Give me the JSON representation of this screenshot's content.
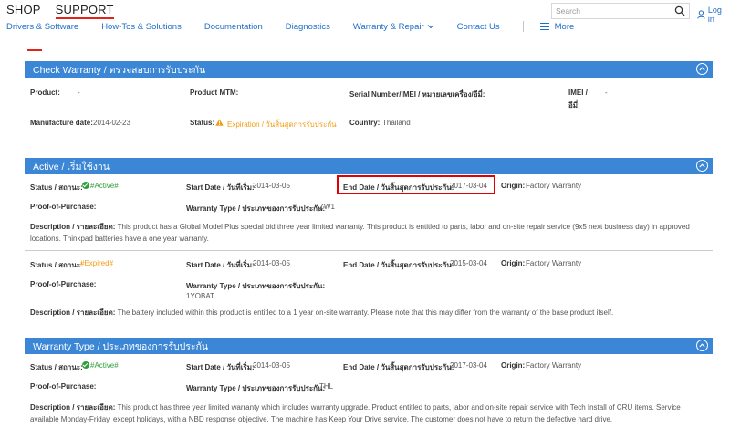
{
  "brand_tabs": {
    "shop": "SHOP",
    "support": "SUPPORT"
  },
  "nav": {
    "drivers": "Drivers & Software",
    "howtos": "How-Tos & Solutions",
    "documentation": "Documentation",
    "diagnostics": "Diagnostics",
    "warranty_repair": "Warranty & Repair",
    "contact": "Contact Us",
    "more": "More"
  },
  "search": {
    "placeholder": "Search"
  },
  "login": "Log in",
  "check_warranty": {
    "title": "Check Warranty / ตรวจสอบการรับประกัน",
    "product_label": "Product:",
    "product_value": "-",
    "mtm_label": "Product MTM:",
    "serial_label": "Serial Number/IMEI / หมายเลขเครื่อง/อีมี่:",
    "imei_label_line1": "IMEI /",
    "imei_label_line2": "อีมี่:",
    "imei_value": "-",
    "manufacture_label": "Manufacture date:",
    "manufacture_value": "2014-02-23",
    "status_label": "Status:",
    "status_value": "Expiration / วันสิ้นสุดการรับประกัน",
    "country_label": "Country:",
    "country_value": "Thailand"
  },
  "active": {
    "title": "Active / เริ่มใช้งาน",
    "entries": [
      {
        "status_label": "Status / สถานะ:",
        "status_value": "#Active#",
        "start_label": "Start Date / วันที่เริ่ม:",
        "start_value": "2014-03-05",
        "end_label": "End Date / วันสิ้นสุดการรับประกัน:",
        "end_value": "2017-03-04",
        "origin_label": "Origin:",
        "origin_value": "Factory Warranty",
        "pop_label": "Proof-of-Purchase:",
        "type_label": "Warranty Type / ประเภทของการรับประกัน:",
        "type_value": "ZW1",
        "desc_label": "Description / รายละเอียด:",
        "desc_value": "This product has a Global Model Plus special bid three year limited warranty. This product is entitled to parts, labor and on-site repair service (9x5 next business day) in approved locations. Thinkpad batteries have a one year warranty."
      },
      {
        "status_label": "Status / สถานะ:",
        "status_value": "#Expired#",
        "start_label": "Start Date / วันที่เริ่ม:",
        "start_value": "2014-03-05",
        "end_label": "End Date / วันสิ้นสุดการรับประกัน:",
        "end_value": "2015-03-04",
        "origin_label": "Origin:",
        "origin_value": "Factory Warranty",
        "pop_label": "Proof-of-Purchase:",
        "type_label": "Warranty Type / ประเภทของการรับประกัน:",
        "type_value": "1YOBAT",
        "desc_label": "Description / รายละเอียด:",
        "desc_value": "The battery included within this product is entitled to a 1 year on-site warranty. Please note that this may differ from the warranty of the base product itself."
      }
    ]
  },
  "warranty_type": {
    "title": "Warranty Type / ประเภทของการรับประกัน",
    "status_label": "Status / สถานะ:",
    "status_value": "#Active#",
    "start_label": "Start Date / วันที่เริ่ม:",
    "start_value": "2014-03-05",
    "end_label": "End Date / วันสิ้นสุดการรับประกัน:",
    "end_value": "2017-03-04",
    "origin_label": "Origin:",
    "origin_value": "Factory Warranty",
    "pop_label": "Proof-of-Purchase:",
    "type_label": "Warranty Type / ประเภทของการรับประกัน:",
    "type_value": "THL",
    "desc_label": "Description / รายละเอียด:",
    "desc_value": "This product has three year limited warranty which includes warranty upgrade. Product entitled to parts, labor and on-site repair service with Tech Install of CRU items. Service available Monday-Friday, except holidays, with a NBD response objective. The machine has Keep Your Drive service. The customer does not have to return the defective hard drive."
  },
  "colors": {
    "accent": "#3c86d6",
    "link": "#1e6ec8",
    "active": "#2e9e3a",
    "warning": "#f39c12",
    "highlight": "#e00000",
    "brand": "#e2231a"
  },
  "icons": [
    "search-icon",
    "user-icon",
    "chevron-down-icon",
    "hamburger-icon",
    "collapse-icon",
    "check-circle-icon",
    "warning-icon"
  ]
}
